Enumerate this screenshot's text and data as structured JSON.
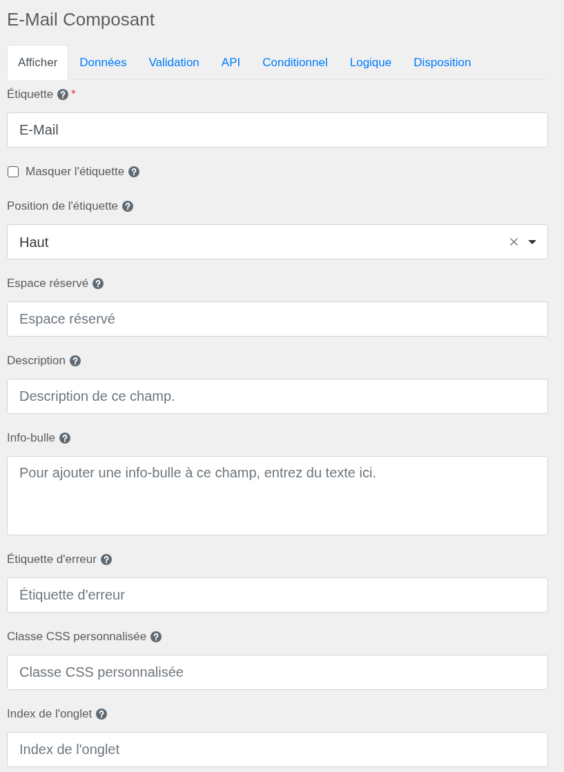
{
  "title": "E-Mail Composant",
  "tabs": [
    {
      "label": "Afficher",
      "selected": true
    },
    {
      "label": "Données",
      "selected": false
    },
    {
      "label": "Validation",
      "selected": false
    },
    {
      "label": "API",
      "selected": false
    },
    {
      "label": "Conditionnel",
      "selected": false
    },
    {
      "label": "Logique",
      "selected": false
    },
    {
      "label": "Disposition",
      "selected": false
    }
  ],
  "fields": [
    {
      "kind": "text",
      "label": "Étiquette",
      "required_mark": "*",
      "value": "E-Mail"
    },
    {
      "kind": "checkbox",
      "label": "Masquer l'étiquette",
      "checked": false
    },
    {
      "kind": "select",
      "label": "Position de l'étiquette",
      "value": "Haut"
    },
    {
      "kind": "text",
      "label": "Espace réservé",
      "placeholder": "Espace réservé"
    },
    {
      "kind": "text",
      "label": "Description",
      "placeholder": "Description de ce champ."
    },
    {
      "kind": "textarea",
      "label": "Info-bulle",
      "placeholder": "Pour ajouter une info-bulle à ce champ, entrez du texte ici."
    },
    {
      "kind": "text",
      "label": "Étiquette d'erreur",
      "placeholder": "Étiquette d'erreur"
    },
    {
      "kind": "text",
      "label": "Classe CSS personnalisée",
      "placeholder": "Classe CSS personnalisée"
    },
    {
      "kind": "text",
      "label": "Index de l'onglet",
      "placeholder": "Index de l'onglet"
    }
  ]
}
